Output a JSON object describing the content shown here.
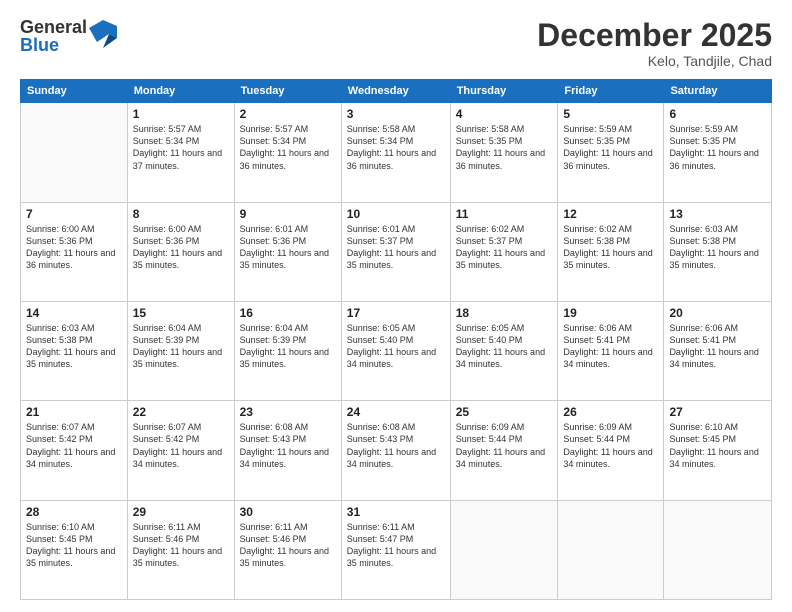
{
  "logo": {
    "general": "General",
    "blue": "Blue"
  },
  "header": {
    "month": "December 2025",
    "location": "Kelo, Tandjile, Chad"
  },
  "weekdays": [
    "Sunday",
    "Monday",
    "Tuesday",
    "Wednesday",
    "Thursday",
    "Friday",
    "Saturday"
  ],
  "weeks": [
    [
      {
        "day": "",
        "info": ""
      },
      {
        "day": "1",
        "info": "Sunrise: 5:57 AM\nSunset: 5:34 PM\nDaylight: 11 hours and 37 minutes."
      },
      {
        "day": "2",
        "info": "Sunrise: 5:57 AM\nSunset: 5:34 PM\nDaylight: 11 hours and 36 minutes."
      },
      {
        "day": "3",
        "info": "Sunrise: 5:58 AM\nSunset: 5:34 PM\nDaylight: 11 hours and 36 minutes."
      },
      {
        "day": "4",
        "info": "Sunrise: 5:58 AM\nSunset: 5:35 PM\nDaylight: 11 hours and 36 minutes."
      },
      {
        "day": "5",
        "info": "Sunrise: 5:59 AM\nSunset: 5:35 PM\nDaylight: 11 hours and 36 minutes."
      },
      {
        "day": "6",
        "info": "Sunrise: 5:59 AM\nSunset: 5:35 PM\nDaylight: 11 hours and 36 minutes."
      }
    ],
    [
      {
        "day": "7",
        "info": "Sunrise: 6:00 AM\nSunset: 5:36 PM\nDaylight: 11 hours and 36 minutes."
      },
      {
        "day": "8",
        "info": "Sunrise: 6:00 AM\nSunset: 5:36 PM\nDaylight: 11 hours and 35 minutes."
      },
      {
        "day": "9",
        "info": "Sunrise: 6:01 AM\nSunset: 5:36 PM\nDaylight: 11 hours and 35 minutes."
      },
      {
        "day": "10",
        "info": "Sunrise: 6:01 AM\nSunset: 5:37 PM\nDaylight: 11 hours and 35 minutes."
      },
      {
        "day": "11",
        "info": "Sunrise: 6:02 AM\nSunset: 5:37 PM\nDaylight: 11 hours and 35 minutes."
      },
      {
        "day": "12",
        "info": "Sunrise: 6:02 AM\nSunset: 5:38 PM\nDaylight: 11 hours and 35 minutes."
      },
      {
        "day": "13",
        "info": "Sunrise: 6:03 AM\nSunset: 5:38 PM\nDaylight: 11 hours and 35 minutes."
      }
    ],
    [
      {
        "day": "14",
        "info": "Sunrise: 6:03 AM\nSunset: 5:38 PM\nDaylight: 11 hours and 35 minutes."
      },
      {
        "day": "15",
        "info": "Sunrise: 6:04 AM\nSunset: 5:39 PM\nDaylight: 11 hours and 35 minutes."
      },
      {
        "day": "16",
        "info": "Sunrise: 6:04 AM\nSunset: 5:39 PM\nDaylight: 11 hours and 35 minutes."
      },
      {
        "day": "17",
        "info": "Sunrise: 6:05 AM\nSunset: 5:40 PM\nDaylight: 11 hours and 34 minutes."
      },
      {
        "day": "18",
        "info": "Sunrise: 6:05 AM\nSunset: 5:40 PM\nDaylight: 11 hours and 34 minutes."
      },
      {
        "day": "19",
        "info": "Sunrise: 6:06 AM\nSunset: 5:41 PM\nDaylight: 11 hours and 34 minutes."
      },
      {
        "day": "20",
        "info": "Sunrise: 6:06 AM\nSunset: 5:41 PM\nDaylight: 11 hours and 34 minutes."
      }
    ],
    [
      {
        "day": "21",
        "info": "Sunrise: 6:07 AM\nSunset: 5:42 PM\nDaylight: 11 hours and 34 minutes."
      },
      {
        "day": "22",
        "info": "Sunrise: 6:07 AM\nSunset: 5:42 PM\nDaylight: 11 hours and 34 minutes."
      },
      {
        "day": "23",
        "info": "Sunrise: 6:08 AM\nSunset: 5:43 PM\nDaylight: 11 hours and 34 minutes."
      },
      {
        "day": "24",
        "info": "Sunrise: 6:08 AM\nSunset: 5:43 PM\nDaylight: 11 hours and 34 minutes."
      },
      {
        "day": "25",
        "info": "Sunrise: 6:09 AM\nSunset: 5:44 PM\nDaylight: 11 hours and 34 minutes."
      },
      {
        "day": "26",
        "info": "Sunrise: 6:09 AM\nSunset: 5:44 PM\nDaylight: 11 hours and 34 minutes."
      },
      {
        "day": "27",
        "info": "Sunrise: 6:10 AM\nSunset: 5:45 PM\nDaylight: 11 hours and 34 minutes."
      }
    ],
    [
      {
        "day": "28",
        "info": "Sunrise: 6:10 AM\nSunset: 5:45 PM\nDaylight: 11 hours and 35 minutes."
      },
      {
        "day": "29",
        "info": "Sunrise: 6:11 AM\nSunset: 5:46 PM\nDaylight: 11 hours and 35 minutes."
      },
      {
        "day": "30",
        "info": "Sunrise: 6:11 AM\nSunset: 5:46 PM\nDaylight: 11 hours and 35 minutes."
      },
      {
        "day": "31",
        "info": "Sunrise: 6:11 AM\nSunset: 5:47 PM\nDaylight: 11 hours and 35 minutes."
      },
      {
        "day": "",
        "info": ""
      },
      {
        "day": "",
        "info": ""
      },
      {
        "day": "",
        "info": ""
      }
    ]
  ]
}
